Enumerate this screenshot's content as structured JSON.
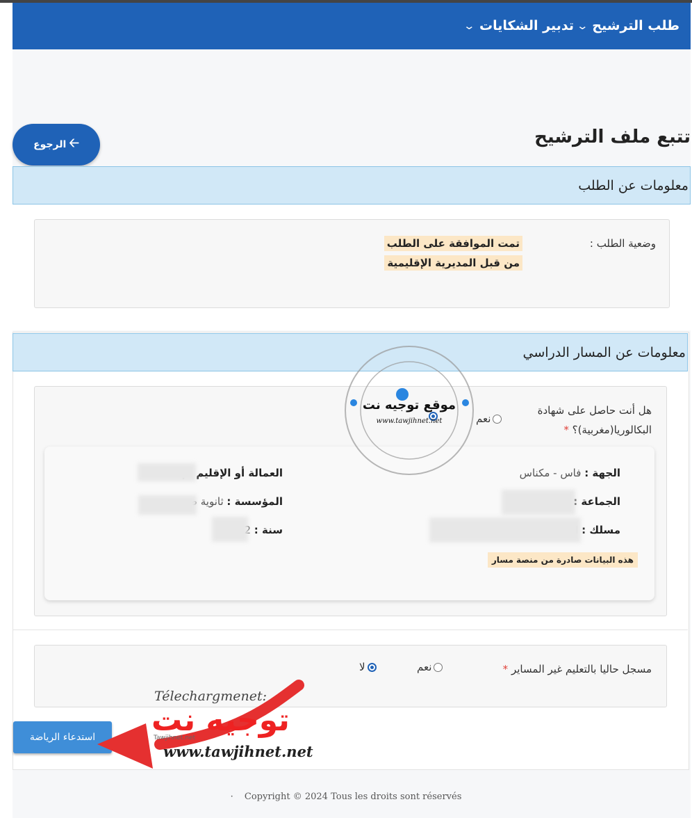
{
  "nav": {
    "items": [
      {
        "label": "طلب الترشيح",
        "chevron": "chevron-down-icon"
      },
      {
        "label": "تدبير الشكايات",
        "chevron": "chevron-down-icon"
      }
    ]
  },
  "page": {
    "title": "تتبع ملف الترشيح",
    "back_label": "الرجوع",
    "back_icon": "arrow-left-icon"
  },
  "request_info": {
    "header": "معلومات عن الطلب",
    "status_label": "وضعية الطلب :",
    "status_value": "تمت الموافقة على الطلب من قبل المديرية الإقليمية"
  },
  "study_path": {
    "header": "معلومات عن المسار الدراسي",
    "bac_question": "هل أنت حاصل على شهادة البكالوريا(مغربية)؟",
    "required_mark": "*",
    "yes_label": "نعم",
    "selected": "no",
    "fields": {
      "region_label": "الجهة :",
      "region_value": "فاس - مكناس",
      "prefecture_label": "العمالة أو الإقليم :",
      "prefecture_value": "إ",
      "commune_label": "الجماعة :",
      "institution_label": "المؤسسة :",
      "institution_value": "ثانوية ص",
      "track_label": "مسلك :",
      "track_value": "ا",
      "year_label": "سنة :",
      "year_value": "2"
    },
    "massar_note": "هذه البيانات صادرة من منصة مسار"
  },
  "non_formal": {
    "question": "مسجل حاليا بالتعليم غير المساير",
    "required_mark": "*",
    "yes_label": "نعم",
    "no_label": "لا",
    "selected": "no"
  },
  "actions": {
    "summon_label": "استدعاء الرياضة"
  },
  "footer": {
    "text": "Copyright © 2024 Tous les droits sont réservés"
  },
  "watermark": {
    "stamp_text": "موقع توجيه نت",
    "stamp_url": "www.tawjihnet.net",
    "download_text": "Télechargmenet:",
    "logo_text": "توجيه نت",
    "logo_small": "Tawjihnet.net",
    "site_url": "www.tawjihnet.net"
  }
}
